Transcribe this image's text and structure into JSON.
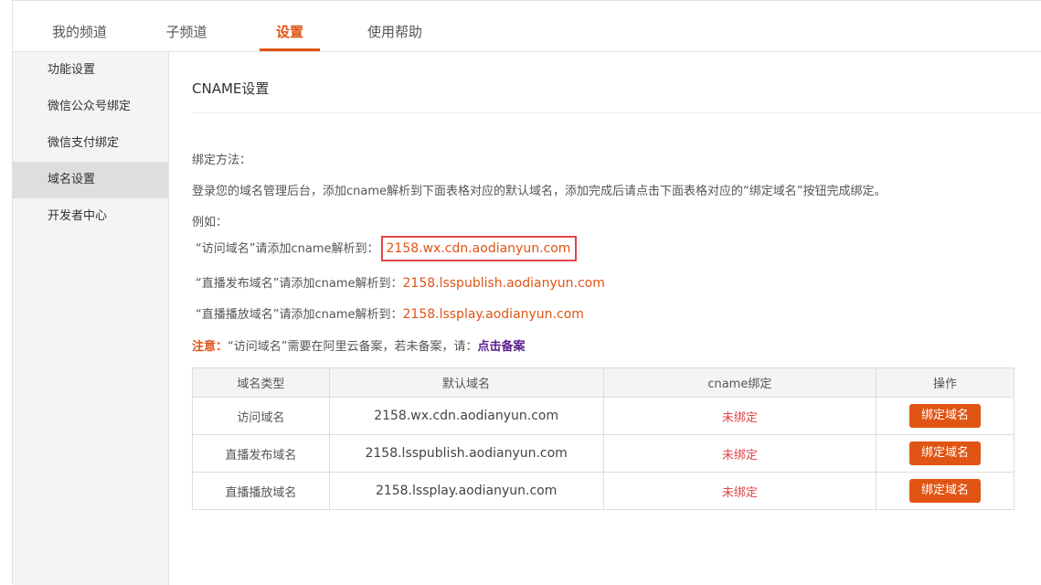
{
  "tabs": [
    {
      "label": "我的频道",
      "active": false
    },
    {
      "label": "子频道",
      "active": false
    },
    {
      "label": "设置",
      "active": true
    },
    {
      "label": "使用帮助",
      "active": false
    }
  ],
  "sidebar": {
    "items": [
      {
        "label": "功能设置",
        "active": false
      },
      {
        "label": "微信公众号绑定",
        "active": false
      },
      {
        "label": "微信支付绑定",
        "active": false
      },
      {
        "label": "域名设置",
        "active": true
      },
      {
        "label": "开发者中心",
        "active": false
      }
    ]
  },
  "main": {
    "title": "CNAME设置",
    "method_label": "绑定方法：",
    "instruction": "登录您的域名管理后台，添加cname解析到下面表格对应的默认域名，添加完成后请点击下面表格对应的“绑定域名”按钮完成绑定。",
    "example_label": "例如：",
    "examples": [
      {
        "prefix": "“访问域名”请添加cname解析到：",
        "domain": "2158.wx.cdn.aodianyun.com"
      },
      {
        "prefix": "“直播发布域名”请添加cname解析到：",
        "domain": "2158.lsspublish.aodianyun.com"
      },
      {
        "prefix": "“直播播放域名”请添加cname解析到：",
        "domain": "2158.lssplay.aodianyun.com"
      }
    ],
    "note_label": "注意：",
    "note_text": "“访问域名”需要在阿里云备案，若未备案，请：",
    "note_link": "点击备案"
  },
  "table": {
    "headers": [
      "域名类型",
      "默认域名",
      "cname绑定",
      "操作"
    ],
    "rows": [
      {
        "type": "访问域名",
        "domain": "2158.wx.cdn.aodianyun.com",
        "status": "未绑定",
        "action": "绑定域名"
      },
      {
        "type": "直播发布域名",
        "domain": "2158.lsspublish.aodianyun.com",
        "status": "未绑定",
        "action": "绑定域名"
      },
      {
        "type": "直播播放域名",
        "domain": "2158.lssplay.aodianyun.com",
        "status": "未绑定",
        "action": "绑定域名"
      }
    ]
  },
  "colors": {
    "accent": "#e05414",
    "status_unbound": "#e0454a",
    "highlight_border": "#e0454a",
    "link_purple": "#5a1e8c"
  }
}
